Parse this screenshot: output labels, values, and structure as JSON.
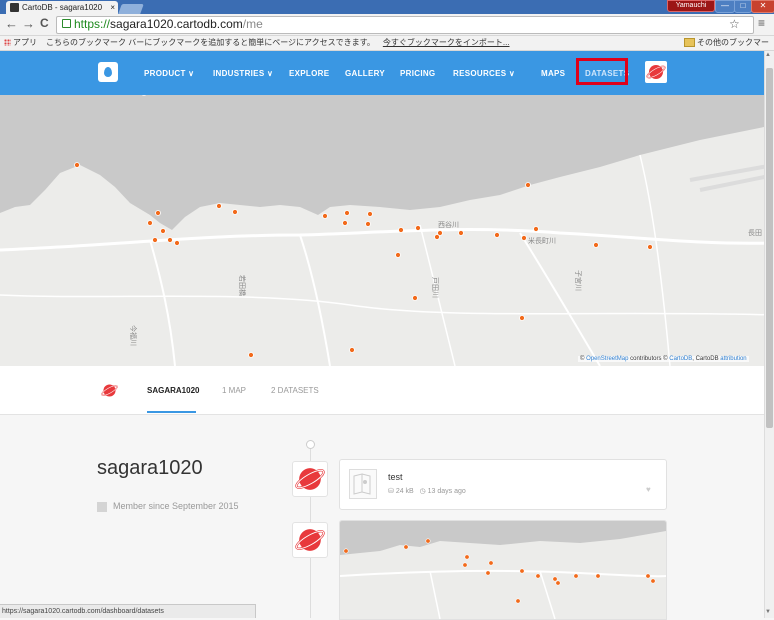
{
  "browser": {
    "tab_title": "CartoDB - sagara1020",
    "tab_close": "×",
    "profile_name": "Yamauchi",
    "win_min": "—",
    "win_max": "□",
    "win_close": "✕",
    "url_scheme": "https://",
    "url_host": "sagara1020.cartodb.com",
    "url_path": "/me",
    "back_icon": "←",
    "forward_icon": "→",
    "reload_icon": "C",
    "star_icon": "☆",
    "menu_icon": "≡",
    "apps_label": "アプリ",
    "bookmarks_message": "こちらのブックマーク バーにブックマークを追加すると簡単にページにアクセスできます。",
    "bookmarks_import": "今すぐブックマークをインポート...",
    "other_bookmarks": "その他のブックマーク",
    "status_url": "https://sagara1020.cartodb.com/dashboard/datasets"
  },
  "header": {
    "nav": [
      {
        "label": "PRODUCT ∨"
      },
      {
        "label": "INDUSTRIES ∨"
      },
      {
        "label": "EXPLORE"
      },
      {
        "label": "GALLERY"
      },
      {
        "label": "PRICING"
      },
      {
        "label": "RESOURCES ∨"
      },
      {
        "label": "MAPS"
      },
      {
        "label": "DATASETS"
      }
    ],
    "highlighted_item": "DATASETS",
    "highlight_color": "#e0001a",
    "accent_color": "#3a97e3"
  },
  "map": {
    "attribution_prefix": "© ",
    "attribution_osm": "OpenStreetMap",
    "attribution_mid": " contributors © ",
    "attribution_cartodb": "CartoDB",
    "attribution_end": ", CartoDB ",
    "attribution_link": "attribution",
    "point_color": "#f26a1b",
    "place_labels": [
      "西谷川",
      "米長町川",
      "長田",
      "戸田川",
      "今福川",
      "若田橋",
      "子宮川"
    ]
  },
  "profile": {
    "tabs": [
      {
        "label": "SAGARA1020",
        "active": true
      },
      {
        "label": "1 MAP"
      },
      {
        "label": "2 DATASETS"
      }
    ],
    "username": "sagara1020",
    "member_since": "Member since September 2015"
  },
  "feed": {
    "dataset": {
      "name": "test",
      "size": "24 kB",
      "updated": "13 days ago",
      "size_icon": "⛁",
      "time_icon": "◷",
      "like_icon": "♥"
    }
  }
}
